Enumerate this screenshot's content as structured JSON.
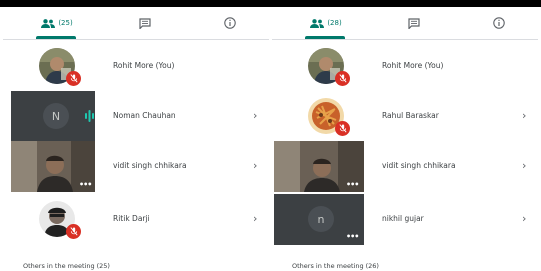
{
  "colors": {
    "accent": "#00796b",
    "mute": "#d93025",
    "text": "#3c4043"
  },
  "icons": {
    "people": "people-icon",
    "chat": "chat-icon",
    "info": "info-icon",
    "mic_off": "mic-off-icon",
    "speaking": "speaking-icon",
    "more": "more-dots-icon",
    "chevron": "chevron-right-icon"
  },
  "panels": [
    {
      "people_count": "(25)",
      "participants": [
        {
          "name": "Rohit More (You)",
          "muted": true
        },
        {
          "name": "Noman Chauhan",
          "initial": "N",
          "speaking": true
        },
        {
          "name": "vidit singh chhikara",
          "video": true
        },
        {
          "name": "Ritik Darji",
          "muted": true
        }
      ],
      "others_label": "Others in the meeting (25)"
    },
    {
      "people_count": "(28)",
      "participants": [
        {
          "name": "Rohit More (You)",
          "muted": true
        },
        {
          "name": "Rahul Baraskar",
          "muted": true
        },
        {
          "name": "vidit singh chhikara",
          "video": true
        },
        {
          "name": "nikhil gujar",
          "initial": "n"
        }
      ],
      "others_label": "Others in the meeting (26)"
    }
  ],
  "chevron_glyph": "›",
  "more_dots": "•••"
}
